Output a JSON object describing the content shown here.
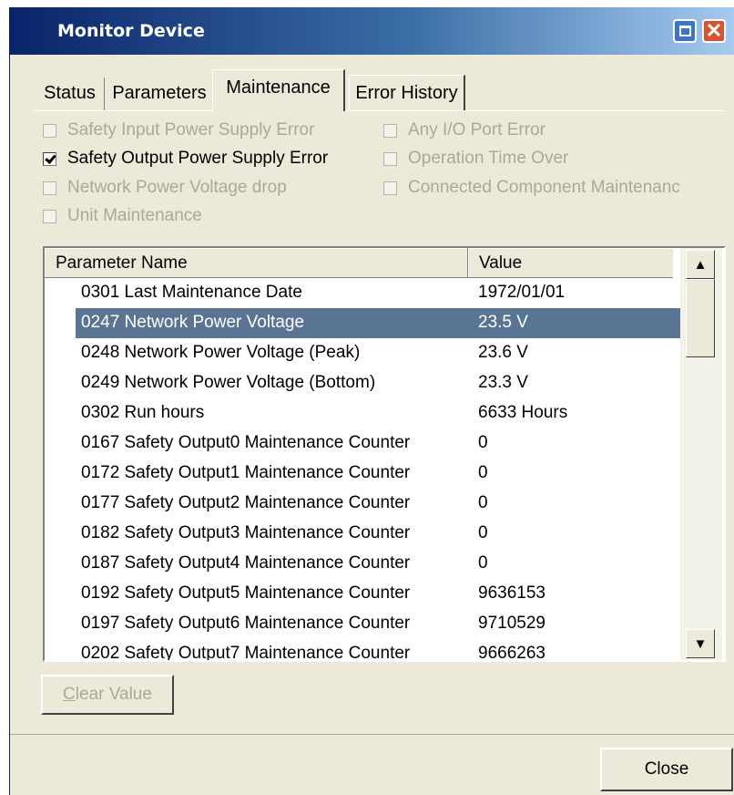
{
  "window": {
    "title": "Monitor Device"
  },
  "tabs": [
    {
      "label": "Status"
    },
    {
      "label": "Parameters"
    },
    {
      "label": "Maintenance"
    },
    {
      "label": "Error History"
    }
  ],
  "checkboxes": {
    "safety_input": {
      "label": "Safety Input Power Supply Error",
      "checked": false,
      "enabled": false
    },
    "safety_output": {
      "label": "Safety Output Power Supply Error",
      "checked": true,
      "enabled": true
    },
    "network_drop": {
      "label": "Network Power Voltage drop",
      "checked": false,
      "enabled": false
    },
    "unit_maint": {
      "label": "Unit Maintenance",
      "checked": false,
      "enabled": false
    },
    "any_io": {
      "label": "Any I/O Port Error",
      "checked": false,
      "enabled": false
    },
    "op_time": {
      "label": "Operation Time Over",
      "checked": false,
      "enabled": false
    },
    "connected": {
      "label": "Connected Component Maintenanc",
      "checked": false,
      "enabled": false
    }
  },
  "table": {
    "columns": [
      "Parameter Name",
      "Value"
    ],
    "rows": [
      {
        "name": "0301 Last Maintenance Date",
        "value": "1972/01/01"
      },
      {
        "name": "0247 Network Power Voltage",
        "value": "23.5 V"
      },
      {
        "name": "0248 Network Power Voltage (Peak)",
        "value": "23.6 V"
      },
      {
        "name": "0249 Network Power Voltage (Bottom)",
        "value": "23.3 V"
      },
      {
        "name": "0302 Run hours",
        "value": "6633 Hours"
      },
      {
        "name": "0167 Safety Output0 Maintenance Counter",
        "value": "0"
      },
      {
        "name": "0172 Safety Output1 Maintenance Counter",
        "value": "0"
      },
      {
        "name": "0177 Safety Output2 Maintenance Counter",
        "value": "0"
      },
      {
        "name": "0182 Safety Output3 Maintenance Counter",
        "value": "0"
      },
      {
        "name": "0187 Safety Output4 Maintenance Counter",
        "value": "0"
      },
      {
        "name": "0192 Safety Output5 Maintenance Counter",
        "value": "9636153"
      },
      {
        "name": "0197 Safety Output6 Maintenance Counter",
        "value": "9710529"
      },
      {
        "name": "0202 Safety Output7 Maintenance Counter",
        "value": "9666263"
      }
    ],
    "selected_row": "0247 Network Power Voltage"
  },
  "buttons": {
    "clear_value": {
      "label_underlined": "C",
      "label_rest": "lear Value"
    },
    "close": "Close"
  },
  "colors": {
    "selection": "#5a7493",
    "title_start": "#0a246a",
    "title_end": "#a6caf0",
    "dialog_bg": "#ece9d8"
  }
}
